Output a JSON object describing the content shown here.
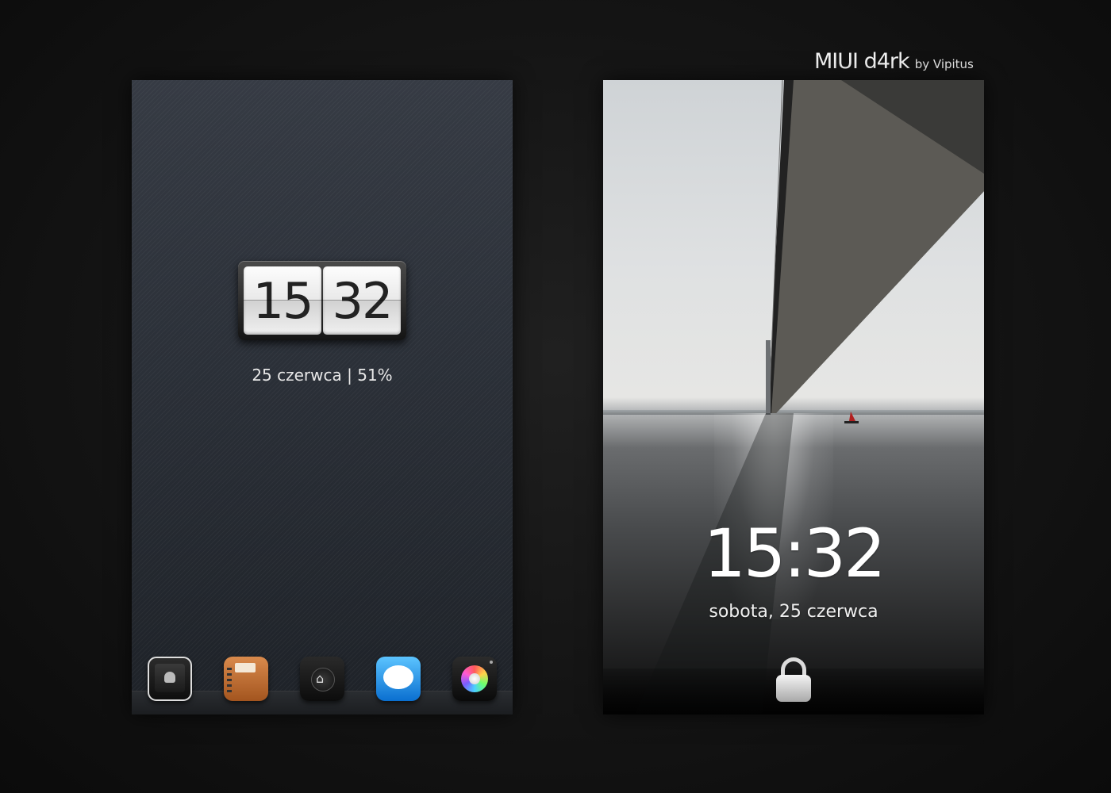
{
  "branding": {
    "title": "MIUI d4rk",
    "byline": "by Vipitus"
  },
  "home_screen": {
    "clock": {
      "hours": "15",
      "minutes": "32"
    },
    "date_battery": "25 czerwca | 51%",
    "dock": [
      {
        "icon": "android-widget-icon"
      },
      {
        "icon": "contacts-book-icon"
      },
      {
        "icon": "home-icon"
      },
      {
        "icon": "messages-icon"
      },
      {
        "icon": "camera-icon"
      }
    ]
  },
  "lock_screen": {
    "time": "15:32",
    "date": "sobota, 25 czerwca",
    "unlock_icon": "lock-icon"
  },
  "colors": {
    "background": "#141414",
    "home_wallpaper": "#2c3139",
    "messages_blue": "#1e90ff"
  }
}
